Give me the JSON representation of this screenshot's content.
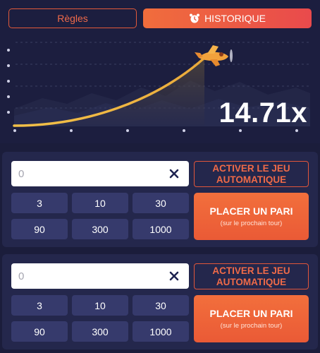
{
  "tabs": {
    "rules_label": "Règles",
    "history_label": "HISTORIQUE"
  },
  "game": {
    "multiplier": "14.71x"
  },
  "panels": [
    {
      "amount_placeholder": "0",
      "auto_label": "ACTIVER LE JEU AUTOMATIQUE",
      "chips": [
        "3",
        "10",
        "30",
        "90",
        "300",
        "1000"
      ],
      "bet_label": "PLACER UN PARI",
      "bet_sub": "(sur le prochain tour)"
    },
    {
      "amount_placeholder": "0",
      "auto_label": "ACTIVER LE JEU AUTOMATIQUE",
      "chips": [
        "3",
        "10",
        "30",
        "90",
        "300",
        "1000"
      ],
      "bet_label": "PLACER UN PARI",
      "bet_sub": "(sur le prochain tour)"
    }
  ],
  "colors": {
    "background": "#1b1d3b",
    "panel": "#24274c",
    "chip": "#363a6c",
    "accent": "#f0643c",
    "curve": "#f0b840"
  },
  "icons": {
    "history": "alarm-clock-icon",
    "clear": "close-icon",
    "plane": "airplane-icon"
  }
}
